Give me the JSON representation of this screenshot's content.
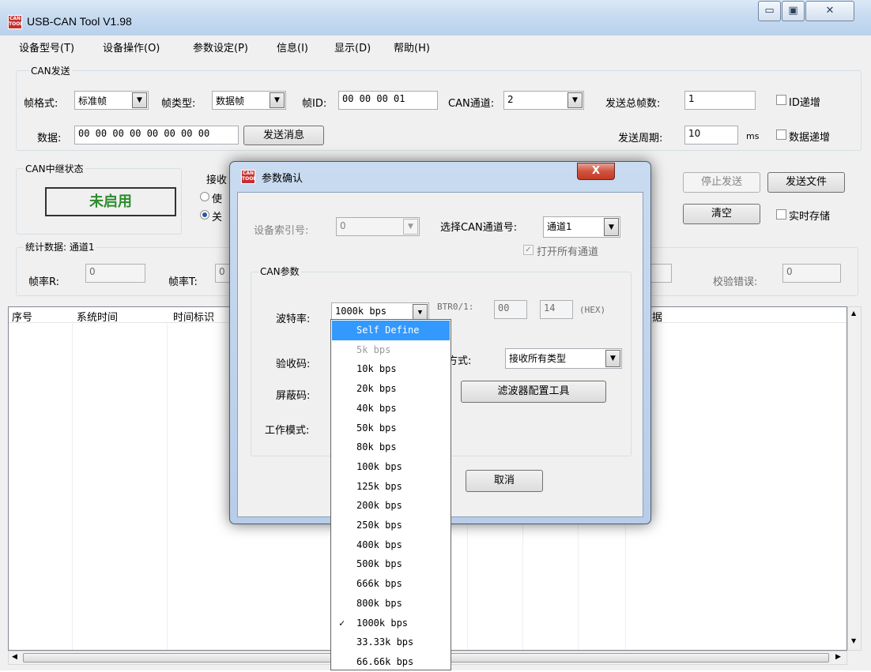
{
  "window": {
    "title": "USB-CAN Tool V1.98",
    "icon_text": "CAN TOOL",
    "controls": {
      "minimize": "▭",
      "maximize": "▣",
      "close": "✕"
    }
  },
  "menu": [
    "设备型号(T)",
    "设备操作(O)",
    "参数设定(P)",
    "信息(I)",
    "显示(D)",
    "帮助(H)"
  ],
  "menu_access": [
    "T",
    "O",
    "P",
    "I",
    "D",
    "H"
  ],
  "can_send": {
    "group_title": "CAN发送",
    "frame_format_label": "帧格式:",
    "frame_format_value": "标准帧",
    "frame_type_label": "帧类型:",
    "frame_type_value": "数据帧",
    "frame_id_label": "帧ID:",
    "frame_id_value": "00 00 00 01",
    "can_channel_label": "CAN通道:",
    "can_channel_value": "2",
    "total_frames_label": "发送总帧数:",
    "total_frames_value": "1",
    "id_increment_label": "ID递增",
    "data_label": "数据:",
    "data_value": "00 00 00 00 00 00 00 00",
    "send_button": "发送消息",
    "period_label": "发送周期:",
    "period_value": "10",
    "period_unit": "ms",
    "data_increment_label": "数据递增"
  },
  "relay": {
    "group_title": "CAN中继状态",
    "status": "未启用",
    "recv_label": "接收",
    "radio1": "使",
    "radio2": "关"
  },
  "right_buttons": {
    "stop_send": "停止发送",
    "send_file": "发送文件",
    "clear": "清空",
    "realtime_save": "实时存储"
  },
  "stats": {
    "group_title": "统计数据: 通道1",
    "frame_rate_r_label": "帧率R:",
    "frame_rate_r_value": "0",
    "frame_rate_t_label": "帧率T:",
    "frame_rate_t_value": "0",
    "hidden_value": "0",
    "check_error_label": "校验错误:",
    "check_error_value": "0"
  },
  "list": {
    "columns": [
      "序号",
      "系统时间",
      "时间标识"
    ],
    "col_tail": "据"
  },
  "dialog": {
    "title": "参数确认",
    "icon_text": "CAN TOOL",
    "close": "X",
    "device_index_label": "设备索引号:",
    "device_index_value": "0",
    "select_channel_label": "选择CAN通道号:",
    "select_channel_value": "通道1",
    "open_all_label": "打开所有通道",
    "can_params_title": "CAN参数",
    "baud_label": "波特率:",
    "baud_value": "1000k bps",
    "btr_label": "BTR0/1:",
    "btr0": "00",
    "btr1": "14",
    "hex_label": "(HEX)",
    "acc_code_label": "验收码:",
    "filter_mode_label": "波方式:",
    "filter_mode_value": "接收所有类型",
    "mask_label": "屏蔽码:",
    "filter_tool_button": "滤波器配置工具",
    "work_mode_label": "工作模式:",
    "cancel_button": "取消"
  },
  "baud_options": [
    {
      "label": "Self Define",
      "state": "selected"
    },
    {
      "label": "5k bps",
      "state": "disabled"
    },
    {
      "label": "10k bps",
      "state": ""
    },
    {
      "label": "20k bps",
      "state": ""
    },
    {
      "label": "40k bps",
      "state": ""
    },
    {
      "label": "50k bps",
      "state": ""
    },
    {
      "label": "80k bps",
      "state": ""
    },
    {
      "label": "100k bps",
      "state": ""
    },
    {
      "label": "125k bps",
      "state": ""
    },
    {
      "label": "200k bps",
      "state": ""
    },
    {
      "label": "250k bps",
      "state": ""
    },
    {
      "label": "400k bps",
      "state": ""
    },
    {
      "label": "500k bps",
      "state": ""
    },
    {
      "label": "666k bps",
      "state": ""
    },
    {
      "label": "800k bps",
      "state": ""
    },
    {
      "label": "1000k bps",
      "state": "checked"
    },
    {
      "label": "33.33k bps",
      "state": ""
    },
    {
      "label": "66.66k bps",
      "state": ""
    }
  ],
  "check_mark": "✓",
  "dropdown_arrow": "▼",
  "colors": {
    "status_green": "#2e8b2e",
    "selection": "#3399ff",
    "close_red": "#c23a24"
  }
}
